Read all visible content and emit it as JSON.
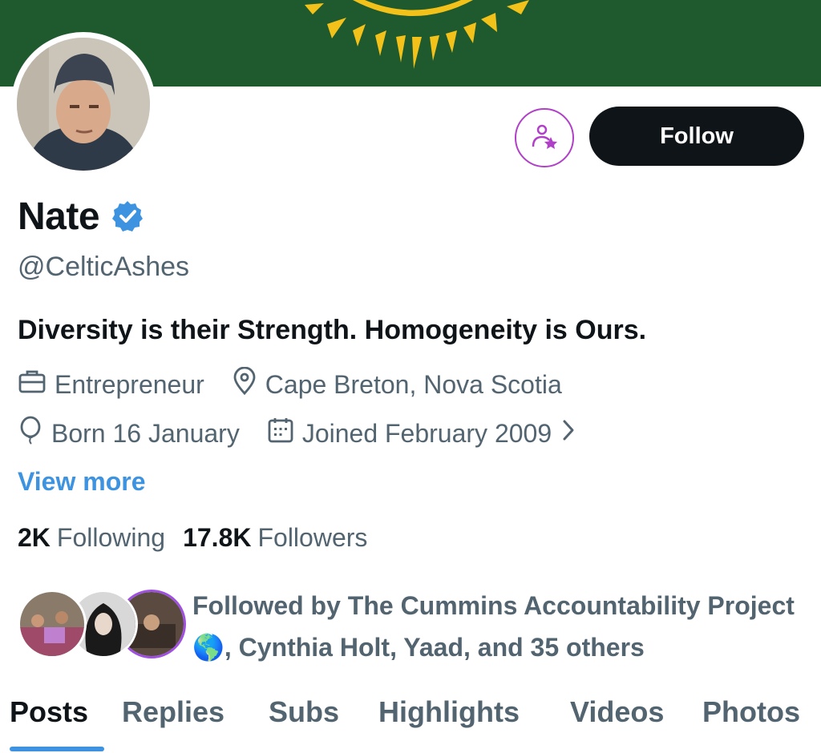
{
  "colors": {
    "banner": "#1f5a2e",
    "sun": "#f2c21a",
    "accent": "#3d93e0",
    "follow_bg": "#0f1419",
    "icon_ring": "#b040c8",
    "secondary_text": "#536471"
  },
  "profile": {
    "name": "Nate",
    "handle": "@CelticAshes",
    "bio": "Diversity is their Strength. Homogeneity is Ours.",
    "profession": "Entrepreneur",
    "location": "Cape Breton, Nova Scotia",
    "birthday": "Born 16 January",
    "joined": "Joined February 2009",
    "view_more": "View more"
  },
  "actions": {
    "follow_label": "Follow",
    "notify_icon": "person-star-icon"
  },
  "stats": {
    "following_count": "2K",
    "following_label": "Following",
    "followers_count": "17.8K",
    "followers_label": "Followers"
  },
  "followed_by": {
    "text": "Followed by The Cummins Accountability Project 🌎, Cynthia Holt, Yaad, and 35 others"
  },
  "tabs": [
    {
      "label": "Posts",
      "active": true
    },
    {
      "label": "Replies"
    },
    {
      "label": "Subs"
    },
    {
      "label": "Highlights"
    },
    {
      "label": "Videos"
    },
    {
      "label": "Photos"
    }
  ]
}
